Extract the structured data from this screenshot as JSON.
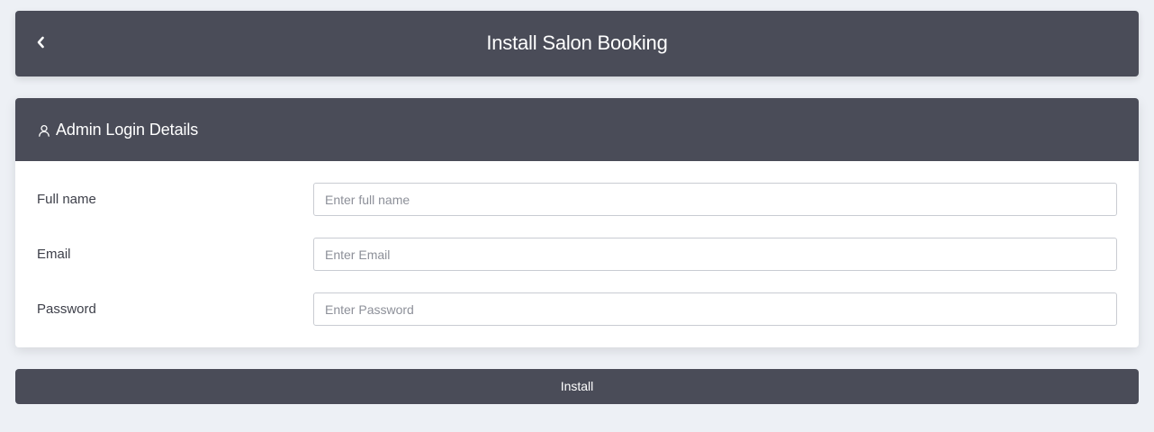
{
  "header": {
    "title": "Install Salon Booking",
    "back_icon": "chevron-left-icon"
  },
  "admin_card": {
    "title": "Admin Login Details",
    "title_icon": "user-icon",
    "fields": [
      {
        "label": "Full name",
        "value": "",
        "placeholder": "Enter full name"
      },
      {
        "label": "Email",
        "value": "",
        "placeholder": "Enter Email"
      },
      {
        "label": "Password",
        "value": "",
        "placeholder": "Enter Password"
      }
    ]
  },
  "actions": {
    "install_label": "Install"
  },
  "colors": {
    "page_background": "#edf0f5",
    "bar_background": "#4a4c58",
    "text_light": "#ffffff",
    "label_text": "#3d3f49",
    "input_border": "#c9ccd2"
  }
}
